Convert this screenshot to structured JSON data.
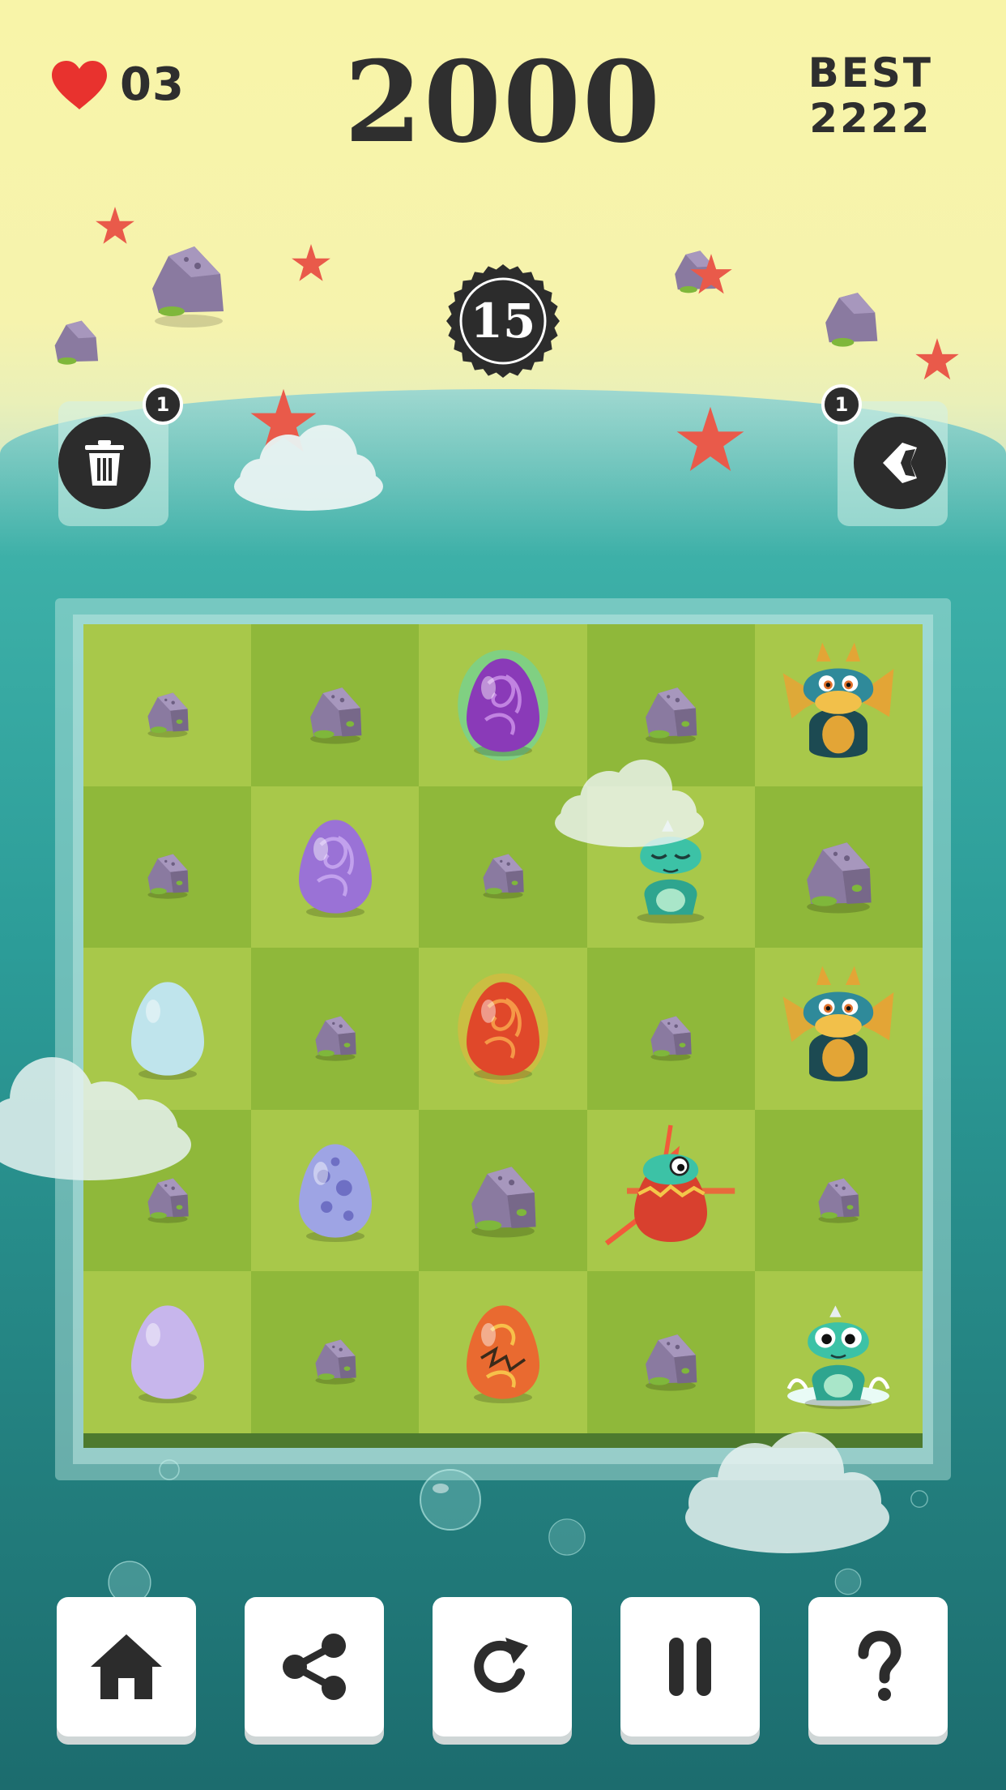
{
  "hud": {
    "lives": "03",
    "score": "2000",
    "best_label": "BEST",
    "best_value": "2222",
    "moves_left": "15"
  },
  "powerups": [
    {
      "name": "trash",
      "icon": "trash-icon",
      "count": "1"
    },
    {
      "name": "undo",
      "icon": "undo-icon",
      "count": "1"
    }
  ],
  "board": {
    "rows": 5,
    "cols": 5,
    "cells": [
      [
        "rock-small",
        "rock-medium",
        "egg-purple-glowing",
        "rock-medium",
        "dragon-winged-adult"
      ],
      [
        "rock-small",
        "egg-purple-swirl",
        "rock-small",
        "dragon-baby-sleeping",
        "rock-large"
      ],
      [
        "egg-light-blue",
        "rock-small",
        "egg-fire-glowing",
        "rock-small",
        "dragon-winged-adult"
      ],
      [
        "rock-small",
        "egg-blue-spotted",
        "rock-large",
        "dragon-hatching-egg",
        "rock-small"
      ],
      [
        "egg-lavender",
        "rock-small",
        "egg-red-cracked",
        "rock-medium",
        "dragon-baby-splash"
      ]
    ]
  },
  "nav": [
    {
      "name": "home",
      "icon": "home-icon"
    },
    {
      "name": "share",
      "icon": "share-icon"
    },
    {
      "name": "restart",
      "icon": "restart-icon"
    },
    {
      "name": "pause",
      "icon": "pause-icon"
    },
    {
      "name": "help",
      "icon": "help-icon"
    }
  ],
  "colors": {
    "sky": "#f6f3ad",
    "sea": "#2c9c98",
    "grass_light": "#a8c84a",
    "grass_dark": "#8fb83a",
    "heart": "#e8322e",
    "text_dark": "#2e2e2e"
  }
}
